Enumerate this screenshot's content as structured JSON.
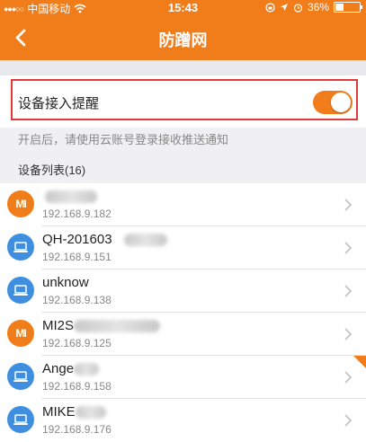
{
  "status_bar": {
    "signal_dots": "●●●○○",
    "carrier": "中国移动",
    "time": "15:43",
    "battery_percent": "36%",
    "battery_level": 0.36
  },
  "nav": {
    "title": "防蹭网",
    "back_icon": "chevron-left-icon"
  },
  "alert_setting": {
    "label": "设备接入提醒",
    "enabled": true
  },
  "hint": "开启后，请使用云账号登录接收推送通知",
  "device_list": {
    "header": "设备列表(16)",
    "items": [
      {
        "icon": "mi-icon",
        "icon_text": "MI",
        "name": "",
        "ip": "192.168.9.182"
      },
      {
        "icon": "laptop-icon",
        "icon_text": "",
        "name": "QH-201603",
        "ip": "192.168.9.151"
      },
      {
        "icon": "laptop-icon",
        "icon_text": "",
        "name": "unknow",
        "ip": "192.168.9.138"
      },
      {
        "icon": "mi-icon",
        "icon_text": "MI",
        "name": "MI2S",
        "ip": "192.168.9.125"
      },
      {
        "icon": "laptop-icon",
        "icon_text": "",
        "name": "Ange",
        "ip": "192.168.9.158"
      },
      {
        "icon": "laptop-icon",
        "icon_text": "",
        "name": "MIKE",
        "ip": "192.168.9.176"
      }
    ]
  },
  "colors": {
    "brand_orange": "#f07d1a",
    "laptop_blue": "#3e8fe0",
    "highlight_red": "#e03a3a"
  }
}
